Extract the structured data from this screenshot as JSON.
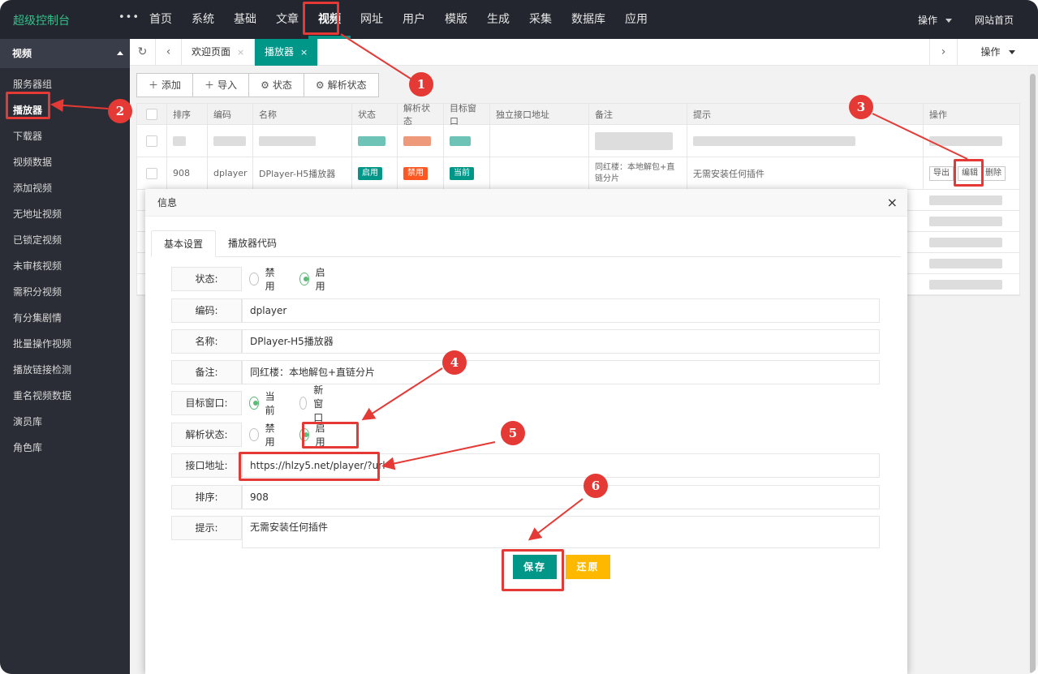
{
  "header": {
    "logo": "超级控制台",
    "more": "•••",
    "nav": [
      "首页",
      "系统",
      "基础",
      "文章",
      "视频",
      "网址",
      "用户",
      "模版",
      "生成",
      "采集",
      "数据库",
      "应用"
    ],
    "active_nav": "视频",
    "right_ops": "操作",
    "right_site": "网站首页"
  },
  "sidebar": {
    "section": "视频",
    "items": [
      "服务器组",
      "播放器",
      "下载器",
      "视频数据",
      "添加视频",
      "无地址视频",
      "已锁定视频",
      "未审核视频",
      "需积分视频",
      "有分集剧情",
      "批量操作视频",
      "播放链接检测",
      "重名视频数据",
      "演员库",
      "角色库"
    ],
    "active": "播放器"
  },
  "tabs": {
    "welcome": "欢迎页面",
    "player": "播放器",
    "close": "×",
    "ops": "操作"
  },
  "toolbar": {
    "add": "添加",
    "import": "导入",
    "status": "状态",
    "parse_status": "解析状态"
  },
  "table": {
    "headers": [
      "排序",
      "编码",
      "名称",
      "状态",
      "解析状态",
      "目标窗口",
      "独立接口地址",
      "备注",
      "提示",
      "操作"
    ],
    "row": {
      "sort": "908",
      "code": "dplayer",
      "name": "DPlayer-H5播放器",
      "status": "启用",
      "parse": "禁用",
      "target": "当前",
      "remark": "同红楼：本地解包+直链分片",
      "tip": "无需安装任何插件",
      "export": "导出",
      "edit": "编辑",
      "delete": "删除"
    }
  },
  "modal": {
    "title": "信息",
    "close": "×",
    "tab_basic": "基本设置",
    "tab_code": "播放器代码",
    "status_label": "状态:",
    "disable": "禁用",
    "enable": "启用",
    "code_label": "编码:",
    "code_value": "dplayer",
    "name_label": "名称:",
    "name_value": "DPlayer-H5播放器",
    "remark_label": "备注:",
    "remark_value": "同红楼：本地解包+直链分片",
    "target_label": "目标窗口:",
    "target_current": "当前",
    "target_new": "新窗口",
    "parse_label": "解析状态:",
    "api_label": "接口地址:",
    "api_value": "https://hlzy5.net/player/?url=",
    "sort_label": "排序:",
    "sort_value": "908",
    "tip_label": "提示:",
    "tip_value": "无需安装任何插件",
    "save": "保存",
    "reset": "还原"
  },
  "annotations": [
    "1",
    "2",
    "3",
    "4",
    "5",
    "6"
  ],
  "colors": {
    "accent": "#009688",
    "annotation": "#e53935",
    "reset": "#ffb800",
    "header": "#23262e"
  }
}
